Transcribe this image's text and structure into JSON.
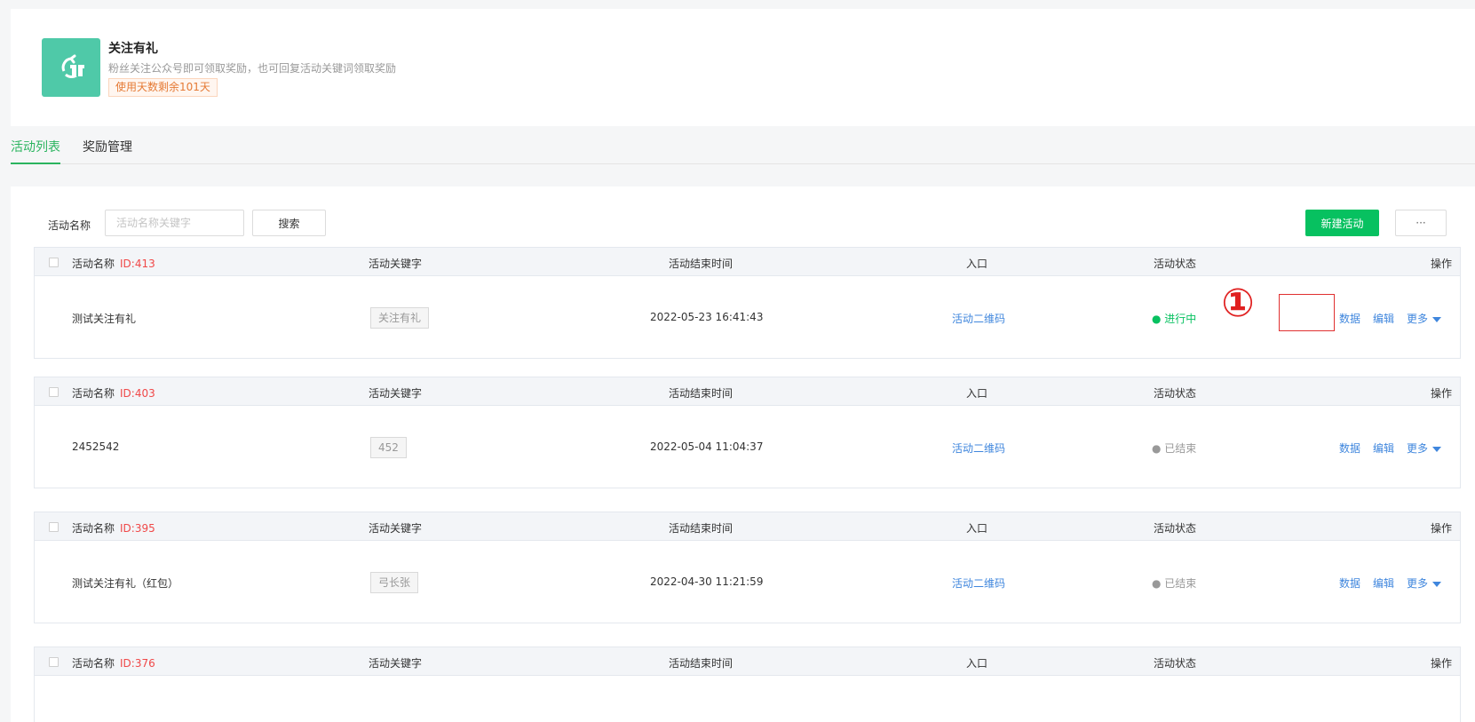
{
  "header": {
    "title": "关注有礼",
    "description": "粉丝关注公众号即可领取奖励，也可回复活动关键词领取奖励",
    "days_badge": "使用天数剩余101天",
    "icon": "gift-recycle-icon",
    "icon_color": "#4fc9a8"
  },
  "tabs": [
    {
      "label": "活动列表",
      "active": true
    },
    {
      "label": "奖励管理",
      "active": false
    }
  ],
  "toolbar": {
    "search_label": "活动名称",
    "search_placeholder": "活动名称关键字",
    "search_button": "搜索",
    "new_button": "新建活动",
    "more_button": "···",
    "accent_color": "#07c160"
  },
  "columns": {
    "name": "活动名称",
    "keyword": "活动关键字",
    "end_time": "活动结束时间",
    "entry": "入口",
    "status": "活动状态",
    "actions": "操作"
  },
  "activities": [
    {
      "id_label": "ID:413",
      "name": "测试关注有礼",
      "keyword": "关注有礼",
      "end_time": "2022-05-23 16:41:43",
      "entry": "活动二维码",
      "status": "● 进行中",
      "active": true,
      "act_data": "数据",
      "act_edit": "编辑",
      "act_more": "更多"
    },
    {
      "id_label": "ID:403",
      "name": "2452542",
      "keyword": "452",
      "end_time": "2022-05-04 11:04:37",
      "entry": "活动二维码",
      "status": "● 已结束",
      "active": false,
      "act_data": "数据",
      "act_edit": "编辑",
      "act_more": "更多"
    },
    {
      "id_label": "ID:395",
      "name": "测试关注有礼（红包）",
      "keyword": "弓长张",
      "end_time": "2022-04-30 11:21:59",
      "entry": "活动二维码",
      "status": "● 已结束",
      "active": false,
      "act_data": "数据",
      "act_edit": "编辑",
      "act_more": "更多"
    },
    {
      "id_label": "ID:376"
    }
  ],
  "annotation": {
    "number": "①",
    "color": "#e02020"
  }
}
